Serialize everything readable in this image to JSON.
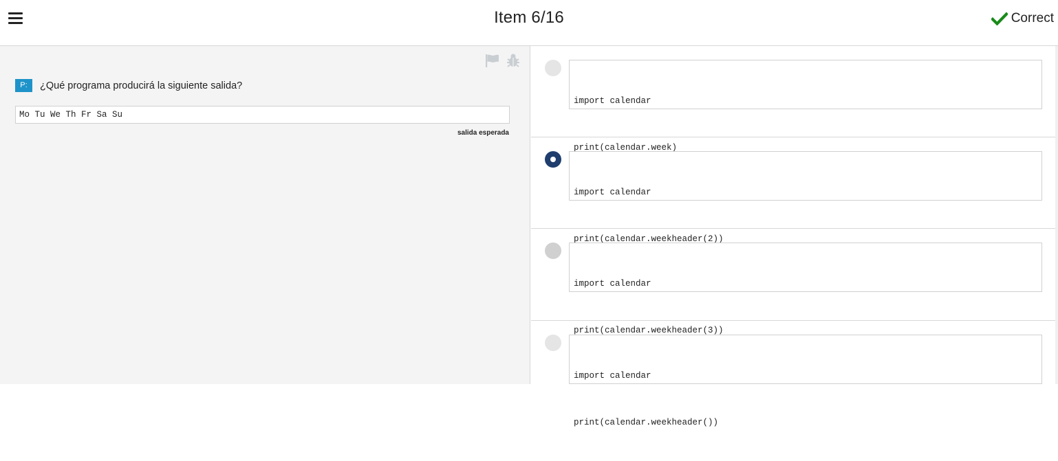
{
  "header": {
    "title": "Item 6/16",
    "status_label": "Correct",
    "status_color": "#1a8a1a",
    "menu_icon": "hamburger-menu-icon",
    "status_icon": "checkmark-icon"
  },
  "question": {
    "badge": "P:",
    "text": "¿Qué programa producirá la siguiente salida?",
    "expected_output": "Mo Tu We Th Fr Sa Su",
    "output_caption": "salida esperada",
    "tool_icons": [
      "flag-icon",
      "bug-icon"
    ]
  },
  "options": [
    {
      "lines": [
        "import calendar",
        "print(calendar.week)"
      ],
      "selected": false
    },
    {
      "lines": [
        "import calendar",
        "print(calendar.weekheader(2))"
      ],
      "selected": true
    },
    {
      "lines": [
        "import calendar",
        "print(calendar.weekheader(3))"
      ],
      "selected": false
    },
    {
      "lines": [
        "import calendar",
        "print(calendar.weekheader())"
      ],
      "selected": false
    }
  ],
  "colors": {
    "accent": "#1f3e6e",
    "badge": "#1e93c9"
  }
}
